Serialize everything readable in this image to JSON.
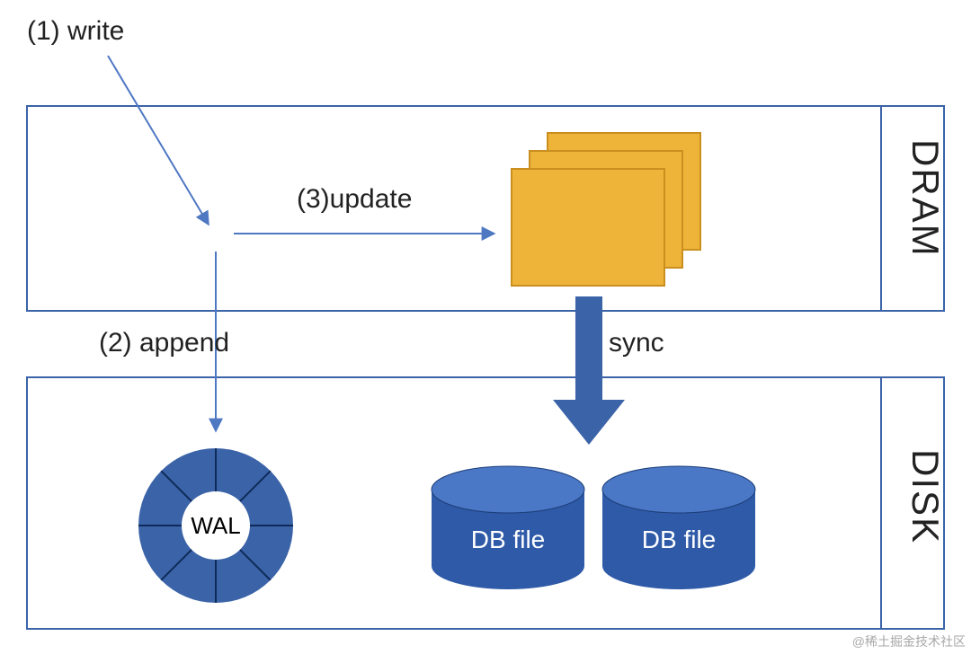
{
  "labels": {
    "write": "(1) write",
    "append": "(2) append",
    "update": "(3)update",
    "sync": "sync",
    "dram": "DRAM",
    "disk": "DISK",
    "wal": "WAL",
    "db1": "DB file",
    "db2": "DB file"
  },
  "colors": {
    "outline": "#3b63a8",
    "arrowThin": "#4f78c3",
    "arrowFat": "#3b63a8",
    "pageFill": "#eeb439",
    "pageStroke": "#c98f1f",
    "donut": "#3b63a8",
    "donutSep": "#ffffff",
    "cylinder": "#2f5aa8"
  },
  "watermark": "@稀土掘金技术社区"
}
